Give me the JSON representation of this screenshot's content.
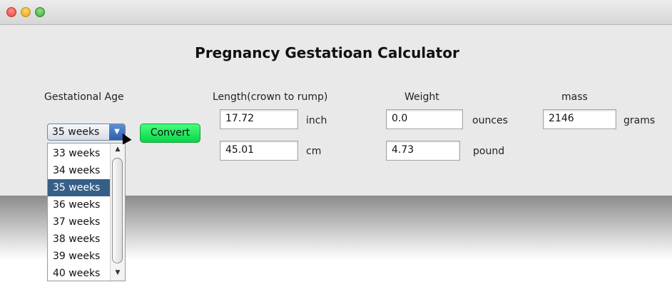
{
  "window": {
    "title": ""
  },
  "app": {
    "title": "Pregnancy Gestatioan Calculator"
  },
  "labels": {
    "gestational_age": "Gestational Age",
    "length": "Length(crown to rump)",
    "weight": "Weight",
    "mass": "mass"
  },
  "gestational_age": {
    "selected": "35 weeks",
    "options": [
      "33 weeks",
      "34 weeks",
      "35 weeks",
      "36 weeks",
      "37 weeks",
      "38 weeks",
      "39 weeks",
      "40 weeks"
    ],
    "selected_index": 2
  },
  "convert_button": {
    "label": "Convert"
  },
  "length": {
    "inch_value": "17.72",
    "inch_unit": "inch",
    "cm_value": "45.01",
    "cm_unit": "cm"
  },
  "weight": {
    "ounces_value": "0.0",
    "ounces_unit": "ounces",
    "pound_value": "4.73",
    "pound_unit": "pound"
  },
  "mass": {
    "grams_value": "2146",
    "grams_unit": "grams"
  },
  "colors": {
    "accent_selected": "#365f88",
    "convert_button": "#1fe05a"
  }
}
